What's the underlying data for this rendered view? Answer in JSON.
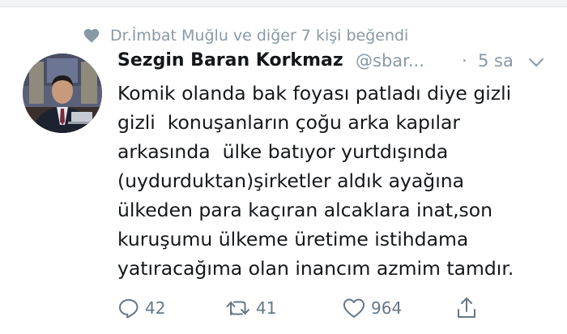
{
  "social_context": {
    "icon": "heart-icon",
    "text": "Dr.İmbat Muğlu ve diğer 7 kişi beğendi"
  },
  "tweet": {
    "author_name": "Sezgin Baran Korkmaz",
    "author_handle": "@sbar...",
    "separator": "·",
    "time": "5 sa",
    "menu_icon": "chevron-down-icon",
    "lines": [
      "Komik olanda bak foyası patladı diye gizli",
      "gizli  konuşanların çoğu arka kapılar",
      "arkasında  ülke batıyor yurtdışında",
      "(uydurduktan)şirketler aldık ayağına",
      "ülkeden para kaçıran alcaklara inat,son",
      "kuruşumu ülkeme üretime istihdama",
      "yatıracağıma olan inancım azmim tamdır."
    ]
  },
  "actions": {
    "reply": {
      "icon": "reply-icon",
      "count": "42"
    },
    "retweet": {
      "icon": "retweet-icon",
      "count": "41"
    },
    "like": {
      "icon": "heart-icon",
      "count": "964"
    },
    "share": {
      "icon": "share-icon"
    }
  },
  "colors": {
    "secondary_text": "#8899a6",
    "action_icon": "#657786",
    "primary_text": "#14171a"
  }
}
